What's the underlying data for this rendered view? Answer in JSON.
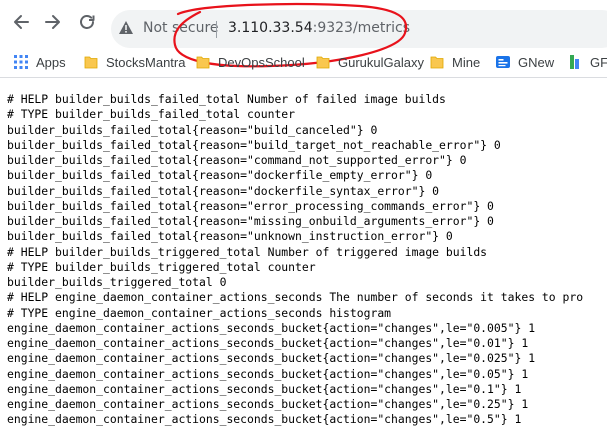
{
  "browser": {
    "security_label": "Not secure",
    "url_host": "3.110.33.54",
    "url_rest": ":9323/metrics",
    "annotation_color": "#e8121b"
  },
  "bookmarks": [
    {
      "icon": "apps-grid-icon",
      "label": "Apps"
    },
    {
      "icon": "folder-icon",
      "label": "StocksMantra"
    },
    {
      "icon": "folder-icon",
      "label": "DevOpsSchool"
    },
    {
      "icon": "folder-icon",
      "label": "GurukulGalaxy"
    },
    {
      "icon": "folder-icon",
      "label": "Mine"
    },
    {
      "icon": "gnews-icon",
      "label": "GNew"
    },
    {
      "icon": "gf-icon",
      "label": "GF"
    }
  ],
  "metrics_lines": [
    "# HELP builder_builds_failed_total Number of failed image builds",
    "# TYPE builder_builds_failed_total counter",
    "builder_builds_failed_total{reason=\"build_canceled\"} 0",
    "builder_builds_failed_total{reason=\"build_target_not_reachable_error\"} 0",
    "builder_builds_failed_total{reason=\"command_not_supported_error\"} 0",
    "builder_builds_failed_total{reason=\"dockerfile_empty_error\"} 0",
    "builder_builds_failed_total{reason=\"dockerfile_syntax_error\"} 0",
    "builder_builds_failed_total{reason=\"error_processing_commands_error\"} 0",
    "builder_builds_failed_total{reason=\"missing_onbuild_arguments_error\"} 0",
    "builder_builds_failed_total{reason=\"unknown_instruction_error\"} 0",
    "# HELP builder_builds_triggered_total Number of triggered image builds",
    "# TYPE builder_builds_triggered_total counter",
    "builder_builds_triggered_total 0",
    "# HELP engine_daemon_container_actions_seconds The number of seconds it takes to pro",
    "# TYPE engine_daemon_container_actions_seconds histogram",
    "engine_daemon_container_actions_seconds_bucket{action=\"changes\",le=\"0.005\"} 1",
    "engine_daemon_container_actions_seconds_bucket{action=\"changes\",le=\"0.01\"} 1",
    "engine_daemon_container_actions_seconds_bucket{action=\"changes\",le=\"0.025\"} 1",
    "engine_daemon_container_actions_seconds_bucket{action=\"changes\",le=\"0.05\"} 1",
    "engine_daemon_container_actions_seconds_bucket{action=\"changes\",le=\"0.1\"} 1",
    "engine_daemon_container_actions_seconds_bucket{action=\"changes\",le=\"0.25\"} 1",
    "engine_daemon_container_actions_seconds_bucket{action=\"changes\",le=\"0.5\"} 1"
  ]
}
